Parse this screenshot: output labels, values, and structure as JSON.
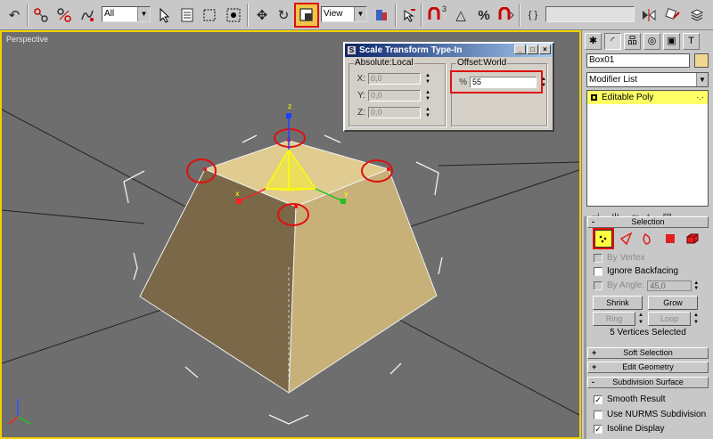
{
  "toolbar": {
    "selection_filter": "All",
    "reference_coord": "View",
    "named_selection": "",
    "percent_snap_glyph": "%",
    "angle_snap_glyph": "△",
    "snap_count": "3",
    "edit_named_glyph": "{ }"
  },
  "viewport": {
    "label": "Perspective",
    "gizmo_z_label": "z",
    "gizmo_x_label": "x",
    "gizmo_y_label": "y"
  },
  "dialog": {
    "title": "Scale Transform Type-In",
    "absolute_group": "Absolute:Local",
    "offset_group": "Offset:World",
    "fields": [
      {
        "label": "X:",
        "value": "0,0"
      },
      {
        "label": "Y:",
        "value": "0,0"
      },
      {
        "label": "Z:",
        "value": "0,0"
      }
    ],
    "percent_label": "%",
    "percent_value": "55"
  },
  "panel": {
    "object_name": "Box01",
    "modifier_list": "Modifier List",
    "stack_item": "Editable Poly",
    "stack_item_dots": "·.·",
    "object_color": "#f0d890",
    "rollouts": {
      "selection": "Selection",
      "soft_selection": "Soft Selection",
      "edit_geometry": "Edit Geometry",
      "subdivision_surface": "Subdivision Surface"
    },
    "by_vertex": "By Vertex",
    "ignore_backfacing": "Ignore Backfacing",
    "by_angle": "By Angle:",
    "by_angle_value": "45,0",
    "shrink": "Shrink",
    "grow": "Grow",
    "ring": "Ring",
    "loop": "Loop",
    "status": "5 Vertices Selected",
    "smooth_result": "Smooth Result",
    "use_nurms": "Use NURMS Subdivision",
    "isoline_display": "Isoline Display"
  },
  "colors": {
    "highlight": "#e01010",
    "selection_yellow": "#ffff40",
    "viewport_border": "#f0d000"
  }
}
